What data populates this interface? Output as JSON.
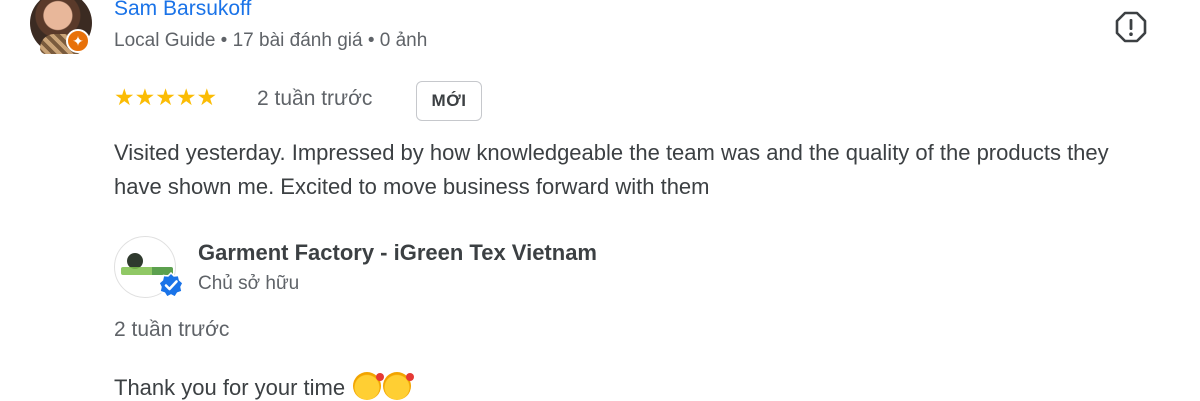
{
  "review": {
    "reviewer_name": "Sam Barsukoff",
    "reviewer_meta": "Local Guide • 17 bài đánh giá • 0 ảnh",
    "rating": 5,
    "stars": "★★★★★",
    "time": "2 tuần trước",
    "badge": "MỚI",
    "text": "Visited yesterday. Impressed by how knowledgeable the team was and the quality of the products they have shown me. Excited to move business forward with them"
  },
  "owner_reply": {
    "owner_name": "Garment Factory - iGreen Tex Vietnam",
    "owner_role": "Chủ sở hữu",
    "time": "2 tuần trước",
    "text": "Thank you for your time"
  },
  "colors": {
    "name_link": "#1a73e8",
    "star": "#fbbc04",
    "local_guide_badge": "#e8710a",
    "verified": "#1a73e8"
  },
  "icons": {
    "report": "report-flag-icon",
    "verified": "verified-check-icon",
    "reply_emojis": [
      "smiling-face-with-hearts-emoji",
      "smiling-face-with-hearts-emoji"
    ]
  }
}
